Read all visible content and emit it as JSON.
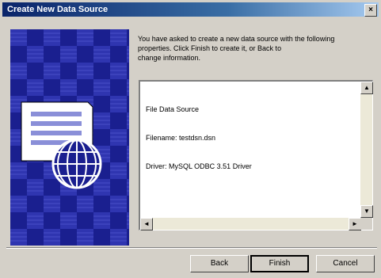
{
  "window": {
    "title": "Create New Data Source",
    "close_label": "×"
  },
  "description": "You have asked to create a new data source with the following\nproperties. Click Finish to create it, or Back to\nchange information.",
  "info_lines": [
    "File Data Source",
    "Filename: testdsn.dsn",
    "Driver: MySQL ODBC 3.51 Driver"
  ],
  "scroll": {
    "up": "▲",
    "down": "▼",
    "left": "◄",
    "right": "►"
  },
  "buttons": {
    "back": "Back",
    "finish": "Finish",
    "cancel": "Cancel"
  },
  "colors": {
    "art_background": "#1a1f8f",
    "art_check": "#2f35b0",
    "title_bar": "#0a246a",
    "dialog_face": "#d4d0c8"
  }
}
